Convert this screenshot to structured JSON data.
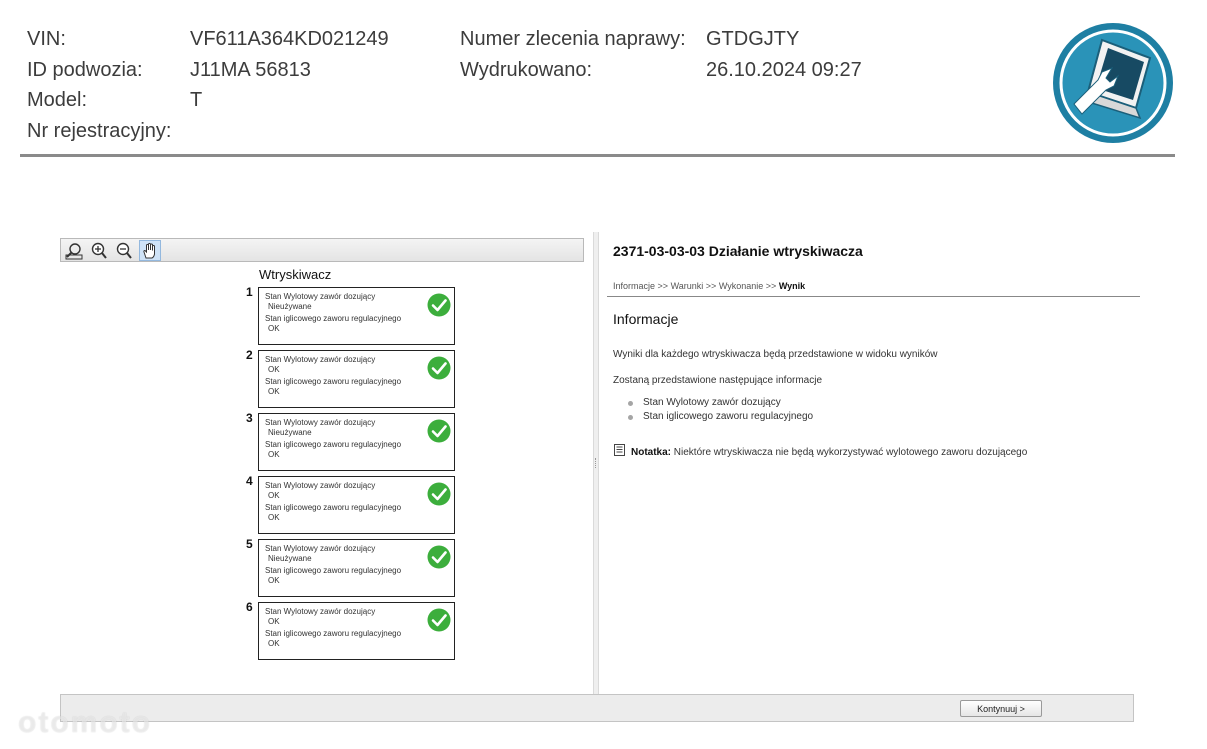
{
  "header": {
    "vin_label": "VIN:",
    "vin_value": "VF611A364KD021249",
    "chassis_label": "ID podwozia:",
    "chassis_value": "J11MA 56813",
    "model_label": "Model:",
    "model_value": "T",
    "registration_label": "Nr rejestracyjny:",
    "order_label": "Numer zlecenia naprawy:",
    "order_value": "GTDGJTY",
    "printed_label": "Wydrukowano:",
    "printed_value": "26.10.2024 09:27",
    "logo_icon": "wrench-laptop-logo-icon"
  },
  "toolbar": {
    "buttons": [
      "zoom-fit-icon",
      "zoom-in-icon",
      "zoom-out-icon",
      "pan-hand-icon"
    ]
  },
  "injectors": {
    "title": "Wtryskiwacz",
    "items": [
      {
        "number": "1",
        "valve_label": "Stan Wylotowy zawór dozujący",
        "valve_value": "Nieużywane",
        "reg_label": "Stan iglicowego zaworu regulacyjnego",
        "reg_value": "OK"
      },
      {
        "number": "2",
        "valve_label": "Stan Wylotowy zawór dozujący",
        "valve_value": "OK",
        "reg_label": "Stan iglicowego zaworu regulacyjnego",
        "reg_value": "OK"
      },
      {
        "number": "3",
        "valve_label": "Stan Wylotowy zawór dozujący",
        "valve_value": "Nieużywane",
        "reg_label": "Stan iglicowego zaworu regulacyjnego",
        "reg_value": "OK"
      },
      {
        "number": "4",
        "valve_label": "Stan Wylotowy zawór dozujący",
        "valve_value": "OK",
        "reg_label": "Stan iglicowego zaworu regulacyjnego",
        "reg_value": "OK"
      },
      {
        "number": "5",
        "valve_label": "Stan Wylotowy zawór dozujący",
        "valve_value": "Nieużywane",
        "reg_label": "Stan iglicowego zaworu regulacyjnego",
        "reg_value": "OK"
      },
      {
        "number": "6",
        "valve_label": "Stan Wylotowy zawór dozujący",
        "valve_value": "OK",
        "reg_label": "Stan iglicowego zaworu regulacyjnego",
        "reg_value": "OK"
      }
    ]
  },
  "content": {
    "title": "2371-03-03-03 Działanie wtryskiwacza",
    "breadcrumb_1": "Informacje",
    "breadcrumb_2": "Warunki",
    "breadcrumb_3": "Wykonanie",
    "breadcrumb_current": "Wynik",
    "breadcrumb_sep": ">>",
    "section_title": "Informacje",
    "paragraph_1": "Wyniki dla każdego wtryskiwacza będą przedstawione w widoku wyników",
    "paragraph_2": "Zostaną przedstawione następujące informacje",
    "bullet_1": "Stan Wylotowy zawór dozujący",
    "bullet_2": "Stan iglicowego zaworu regulacyjnego",
    "note_label": "Notatka:",
    "note_text": "Niektóre wtryskiwacza nie będą wykorzystywać wylotowego zaworu dozującego"
  },
  "footer": {
    "continue_label": "Kontynuuj >"
  },
  "watermark": "otomoto",
  "colors": {
    "logo_blue": "#1e7fa3",
    "check_green": "#3cae3c",
    "rule_gray": "#8a8a8a"
  }
}
